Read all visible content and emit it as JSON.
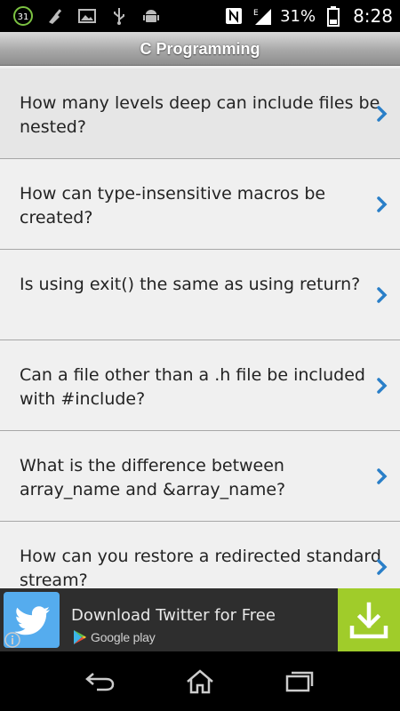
{
  "status_bar": {
    "notification_badge": "31",
    "battery_percent": "31%",
    "time": "8:28",
    "icons": [
      "notification-count-icon",
      "cleaner-icon",
      "image-icon",
      "usb-icon",
      "android-icon",
      "nfc-icon",
      "signal-icon",
      "battery-icon"
    ]
  },
  "header": {
    "title": "C Programming"
  },
  "questions": [
    {
      "text": "How many levels deep can include files be nested?"
    },
    {
      "text": "How can type-insensitive macros be created?"
    },
    {
      "text": "Is using exit() the same as using return?"
    },
    {
      "text": "Can a file other than a .h file be included with #include?"
    },
    {
      "text": "What is the difference between array_name and &array_name?"
    },
    {
      "text": "How can you restore a redirected standard stream?"
    }
  ],
  "ad": {
    "title": "Download Twitter for Free",
    "store_label": "Google play",
    "colors": {
      "logo_bg": "#55acee",
      "download_bg": "#a0cc2a"
    }
  },
  "nav": {
    "buttons": [
      "back",
      "home",
      "recents"
    ]
  },
  "colors": {
    "accent_chevron": "#2a7fc8"
  }
}
